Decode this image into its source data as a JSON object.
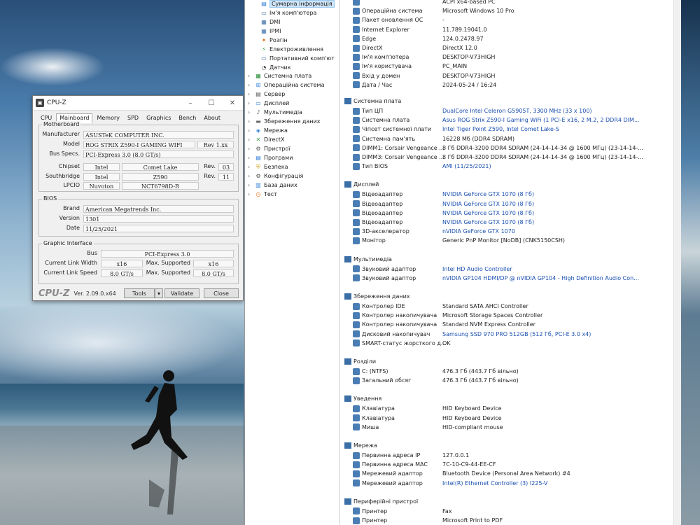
{
  "cpuz": {
    "title": "CPU-Z",
    "tabs": [
      "CPU",
      "Mainboard",
      "Memory",
      "SPD",
      "Graphics",
      "Bench",
      "About"
    ],
    "motherboard": {
      "group": "Motherboard",
      "manufacturer_label": "Manufacturer",
      "manufacturer": "ASUSTeK COMPUTER INC.",
      "model_label": "Model",
      "model": "ROG STRIX Z590-I GAMING WIFI",
      "rev": "Rev 1.xx",
      "bus_label": "Bus Specs.",
      "bus": "PCI-Express 3.0 (8.0 GT/s)",
      "chipset_label": "Chipset",
      "chipset_vendor": "Intel",
      "chipset_name": "Comet Lake",
      "chipset_rev_label": "Rev.",
      "chipset_rev": "03",
      "southbridge_label": "Southbridge",
      "southbridge_vendor": "Intel",
      "southbridge_name": "Z590",
      "southbridge_rev_label": "Rev.",
      "southbridge_rev": "11",
      "lpcio_label": "LPCIO",
      "lpcio_vendor": "Nuvoton",
      "lpcio_name": "NCT6798D-R"
    },
    "bios": {
      "group": "BIOS",
      "brand_label": "Brand",
      "brand": "American Megatrends Inc.",
      "version_label": "Version",
      "version": "1301",
      "date_label": "Date",
      "date": "11/25/2021"
    },
    "graphic": {
      "group": "Graphic Interface",
      "bus_label": "Bus",
      "bus": "PCI-Express 3.0",
      "link_width_label": "Current Link Width",
      "link_width": "x16",
      "max_supported_label": "Max. Supported",
      "max_width": "x16",
      "link_speed_label": "Current Link Speed",
      "link_speed": "8.0 GT/s",
      "max_speed": "8.0 GT/s"
    },
    "bottom": {
      "logo": "CPU-Z",
      "version": "Ver. 2.09.0.x64",
      "tools": "Tools",
      "validate": "Validate",
      "close": "Close"
    }
  },
  "tree": {
    "items": [
      {
        "label": "Сумарна інформація",
        "icon": "summary-icon",
        "color": "#2c7bd6"
      },
      {
        "label": "Ім'я комп'ютера",
        "icon": "computer-icon",
        "color": "#3a6ea5"
      },
      {
        "label": "DMI",
        "icon": "dmi-icon",
        "color": "#3a6ea5"
      },
      {
        "label": "IPMI",
        "icon": "ipmi-icon",
        "color": "#3a6ea5"
      },
      {
        "label": "Розгін",
        "icon": "overclock-icon",
        "color": "#e0701a"
      },
      {
        "label": "Електроживлення",
        "icon": "power-icon",
        "color": "#3aa04a"
      },
      {
        "label": "Портативний комп'ют",
        "icon": "laptop-icon",
        "color": "#3a6ea5"
      },
      {
        "label": "Датчик",
        "icon": "sensor-icon",
        "color": "#555555"
      },
      {
        "label": "Системна плата",
        "icon": "motherboard-icon",
        "color": "#2a8a3a"
      },
      {
        "label": "Операційна система",
        "icon": "windows-icon",
        "color": "#2c7bd6"
      },
      {
        "label": "Сервер",
        "icon": "server-icon",
        "color": "#555555"
      },
      {
        "label": "Дисплей",
        "icon": "display-icon",
        "color": "#2c7bd6"
      },
      {
        "label": "Мультимедіа",
        "icon": "multimedia-icon",
        "color": "#555555"
      },
      {
        "label": "Збереження даних",
        "icon": "storage-icon",
        "color": "#666666"
      },
      {
        "label": "Мережа",
        "icon": "network-icon",
        "color": "#2c7bd6"
      },
      {
        "label": "DirectX",
        "icon": "directx-icon",
        "color": "#3aa04a"
      },
      {
        "label": "Пристрої",
        "icon": "devices-icon",
        "color": "#555555"
      },
      {
        "label": "Програми",
        "icon": "programs-icon",
        "color": "#2c7bd6"
      },
      {
        "label": "Безпека",
        "icon": "security-icon",
        "color": "#d0a020"
      },
      {
        "label": "Конфігурація",
        "icon": "config-icon",
        "color": "#555555"
      },
      {
        "label": "База даних",
        "icon": "database-icon",
        "color": "#2c7bd6"
      },
      {
        "label": "Тест",
        "icon": "test-icon",
        "color": "#e0701a"
      }
    ]
  },
  "detail": {
    "top_rows": [
      {
        "field": "",
        "value": "ACPI x64-based PC",
        "icon": "computer-type-icon"
      },
      {
        "field": "Операційна система",
        "value": "Microsoft Windows 10 Pro",
        "icon": "windows-icon"
      },
      {
        "field": "Пакет оновлення ОС",
        "value": "-",
        "icon": "update-icon"
      },
      {
        "field": "Internet Explorer",
        "value": "11.789.19041.0",
        "icon": "ie-icon"
      },
      {
        "field": "Edge",
        "value": "124.0.2478.97",
        "icon": "edge-icon"
      },
      {
        "field": "DirectX",
        "value": "DirectX 12.0",
        "icon": "directx-icon"
      },
      {
        "field": "Ім'я комп'ютера",
        "value": "DESKTOP-V73HIGH",
        "icon": "computer-icon"
      },
      {
        "field": "Ім'я користувача",
        "value": "PC_MAIN",
        "icon": "user-icon"
      },
      {
        "field": "Вхід у домен",
        "value": "DESKTOP-V73HIGH",
        "icon": "domain-icon"
      },
      {
        "field": "Дата / Час",
        "value": "2024-05-24 / 16:24",
        "icon": "calendar-icon"
      }
    ],
    "sections": [
      {
        "title": "Системна плата",
        "rows": [
          {
            "field": "Тип ЦП",
            "value": "DualCore Intel Celeron G5905T, 3300 MHz (33 x 100)",
            "link": true
          },
          {
            "field": "Системна плата",
            "value": "Asus ROG Strix Z590-I Gaming WiFi  (1 PCI-E x16, 2 M.2, 2 DDR4 DIM...",
            "link": true
          },
          {
            "field": "Чіпсет системної плати",
            "value": "Intel Tiger Point Z590, Intel Comet Lake-S",
            "link": true
          },
          {
            "field": "Системна пам'ять",
            "value": "16228 Мб  (DDR4 SDRAM)",
            "link": false
          },
          {
            "field": "DIMM1: Corsair Vengeance ...",
            "value": "8 Гб DDR4-3200 DDR4 SDRAM  (24-14-14-34 @ 1600 МГц)  (23-14-14-...",
            "link": false
          },
          {
            "field": "DIMM3: Corsair Vengeance ...",
            "value": "8 Гб DDR4-3200 DDR4 SDRAM  (24-14-14-34 @ 1600 МГц)  (23-14-14-...",
            "link": false
          },
          {
            "field": "Тип BIOS",
            "value": "AMI (11/25/2021)",
            "link": true
          }
        ]
      },
      {
        "title": "Дисплей",
        "rows": [
          {
            "field": "Відеоадаптер",
            "value": "NVIDIA GeForce GTX 1070  (8 Гб)",
            "link": true
          },
          {
            "field": "Відеоадаптер",
            "value": "NVIDIA GeForce GTX 1070  (8 Гб)",
            "link": true
          },
          {
            "field": "Відеоадаптер",
            "value": "NVIDIA GeForce GTX 1070  (8 Гб)",
            "link": true
          },
          {
            "field": "Відеоадаптер",
            "value": "NVIDIA GeForce GTX 1070  (8 Гб)",
            "link": true
          },
          {
            "field": "3D-акселератор",
            "value": "nVIDIA GeForce GTX 1070",
            "link": true
          },
          {
            "field": "Монітор",
            "value": "Generic PnP Monitor [NoDB]  (CNK5150CSH)",
            "link": false
          }
        ]
      },
      {
        "title": "Мультимедіа",
        "rows": [
          {
            "field": "Звуковий адаптор",
            "value": "Intel HD Audio Controller",
            "link": true
          },
          {
            "field": "Звуковий адаптор",
            "value": "nVIDIA GP104 HDMI/DP @ nVIDIA GP104 - High Definition Audio Con...",
            "link": true
          }
        ]
      },
      {
        "title": "Збереження даних",
        "rows": [
          {
            "field": "Контролер IDE",
            "value": "Standard SATA AHCI Controller",
            "link": false
          },
          {
            "field": "Контролер накопичувача",
            "value": "Microsoft Storage Spaces Controller",
            "link": false
          },
          {
            "field": "Контролер накопичувача",
            "value": "Standard NVM Express Controller",
            "link": false
          },
          {
            "field": "Дисковий накопичувач",
            "value": "Samsung SSD 970 PRO 512GB  (512 Гб, PCI-E 3.0 x4)",
            "link": true
          },
          {
            "field": "SMART-статус жорсткого д...",
            "value": "OK",
            "link": false
          }
        ]
      },
      {
        "title": "Розділи",
        "rows": [
          {
            "field": "C: (NTFS)",
            "value": "476.3 Гб (443.7 Гб вільно)",
            "link": false
          },
          {
            "field": "Загальний обсяг",
            "value": "476.3 Гб (443.7 Гб вільно)",
            "link": false
          }
        ]
      },
      {
        "title": "Уведення",
        "rows": [
          {
            "field": "Клавіатура",
            "value": "HID Keyboard Device",
            "link": false
          },
          {
            "field": "Клавіатура",
            "value": "HID Keyboard Device",
            "link": false
          },
          {
            "field": "Миша",
            "value": "HID-compliant mouse",
            "link": false
          }
        ]
      },
      {
        "title": "Мережа",
        "rows": [
          {
            "field": "Первинна адреса IP",
            "value": "127.0.0.1",
            "link": false
          },
          {
            "field": "Первинна адреса MAC",
            "value": "7C-10-C9-44-EE-CF",
            "link": false
          },
          {
            "field": "Мережевий адаптор",
            "value": "Bluetooth Device (Personal Area Network) #4",
            "link": false
          },
          {
            "field": "Мережевий адаптор",
            "value": "Intel(R) Ethernet Controller (3) I225-V",
            "link": true
          }
        ]
      },
      {
        "title": "Периферійні пристрої",
        "rows": [
          {
            "field": "Принтер",
            "value": "Fax",
            "link": false
          },
          {
            "field": "Принтер",
            "value": "Microsoft Print to PDF",
            "link": false
          }
        ]
      }
    ]
  },
  "colors": {
    "link": "#1a4fb0",
    "section_icon": "#3a6ea5",
    "selection": "#cde4f7"
  }
}
